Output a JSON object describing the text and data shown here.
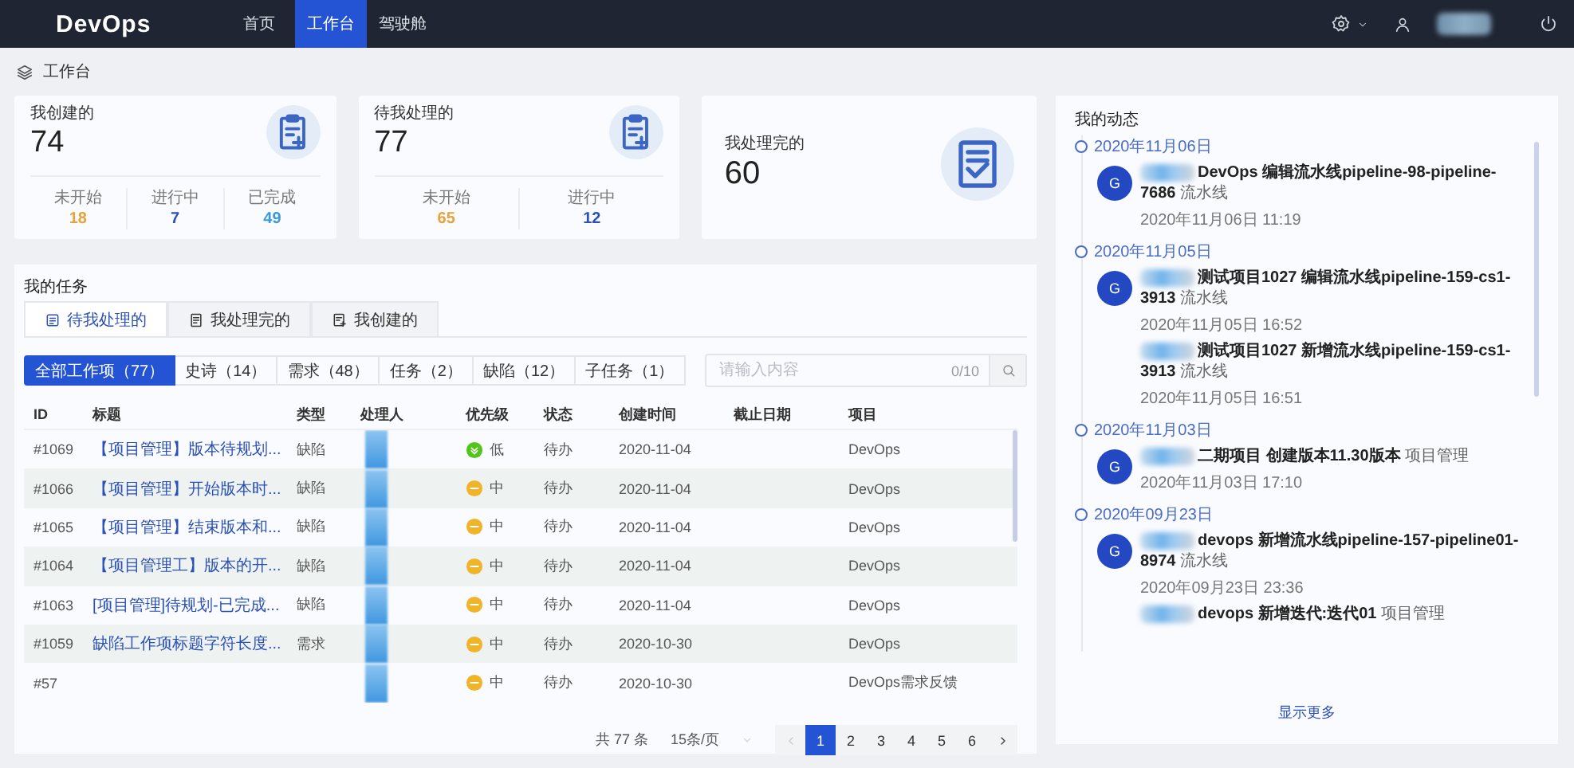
{
  "topbar": {
    "logo": "DevOps",
    "nav": [
      {
        "label": "首页",
        "selected": false
      },
      {
        "label": "工作台",
        "selected": true
      },
      {
        "label": "驾驶舱",
        "selected": false
      }
    ]
  },
  "breadcrumb": "工作台",
  "cards": [
    {
      "title": "我创建的",
      "value": "74",
      "stats": [
        {
          "label": "未开始",
          "value": "18",
          "color": "#e6a23c"
        },
        {
          "label": "进行中",
          "value": "7",
          "color": "#2b50b8"
        },
        {
          "label": "已完成",
          "value": "49",
          "color": "#3a9ad9"
        }
      ]
    },
    {
      "title": "待我处理的",
      "value": "77",
      "stats": [
        {
          "label": "未开始",
          "value": "65",
          "color": "#e6a23c"
        },
        {
          "label": "进行中",
          "value": "12",
          "color": "#2b50b8"
        }
      ]
    },
    {
      "title": "我处理完的",
      "value": "60"
    }
  ],
  "tasks": {
    "title": "我的任务",
    "tabs": [
      {
        "label": "待我处理的",
        "selected": true
      },
      {
        "label": "我处理完的",
        "selected": false
      },
      {
        "label": "我创建的",
        "selected": false
      }
    ],
    "filters": [
      {
        "label": "全部工作项（77）",
        "selected": true
      },
      {
        "label": "史诗（14）",
        "selected": false
      },
      {
        "label": "需求（48）",
        "selected": false
      },
      {
        "label": "任务（2）",
        "selected": false
      },
      {
        "label": "缺陷（12）",
        "selected": false
      },
      {
        "label": "子任务（1）",
        "selected": false
      }
    ],
    "search": {
      "placeholder": "请输入内容",
      "counter": "0/10"
    },
    "columns": [
      "ID",
      "标题",
      "类型",
      "处理人",
      "优先级",
      "状态",
      "创建时间",
      "截止日期",
      "项目"
    ],
    "rows": [
      {
        "id": "#1069",
        "title": "【项目管理】版本待规划...",
        "type": "缺陷",
        "priority": {
          "kind": "low",
          "label": "低"
        },
        "status": "待办",
        "created": "2020-11-04",
        "project": "DevOps"
      },
      {
        "id": "#1066",
        "title": "【项目管理】开始版本时...",
        "type": "缺陷",
        "priority": {
          "kind": "medium",
          "label": "中"
        },
        "status": "待办",
        "created": "2020-11-04",
        "project": "DevOps"
      },
      {
        "id": "#1065",
        "title": "【项目管理】结束版本和...",
        "type": "缺陷",
        "priority": {
          "kind": "medium",
          "label": "中"
        },
        "status": "待办",
        "created": "2020-11-04",
        "project": "DevOps"
      },
      {
        "id": "#1064",
        "title": "【项目管理工】版本的开...",
        "type": "缺陷",
        "priority": {
          "kind": "medium",
          "label": "中"
        },
        "status": "待办",
        "created": "2020-11-04",
        "project": "DevOps"
      },
      {
        "id": "#1063",
        "title": "[项目管理]待规划-已完成...",
        "type": "缺陷",
        "priority": {
          "kind": "medium",
          "label": "中"
        },
        "status": "待办",
        "created": "2020-11-04",
        "project": "DevOps"
      },
      {
        "id": "#1059",
        "title": "缺陷工作项标题字符长度...",
        "type": "需求",
        "priority": {
          "kind": "medium",
          "label": "中"
        },
        "status": "待办",
        "created": "2020-10-30",
        "project": "DevOps"
      },
      {
        "id": "#57",
        "priority": {
          "kind": "medium",
          "label": "中"
        },
        "status": "待办",
        "created": "2020-10-30",
        "project": "DevOps需求反馈"
      }
    ],
    "pagination": {
      "total": "共 77 条",
      "page_size": "15条/页",
      "pages": [
        {
          "label": "1",
          "selected": true
        },
        {
          "label": "2",
          "selected": false
        },
        {
          "label": "3",
          "selected": false
        },
        {
          "label": "4",
          "selected": false
        },
        {
          "label": "5",
          "selected": false
        },
        {
          "label": "6",
          "selected": false
        }
      ]
    }
  },
  "activity": {
    "title": "我的动态",
    "more": "显示更多",
    "groups": [
      {
        "date": "2020年11月06日",
        "items": [
          {
            "avatar": "G",
            "text": "**DevOps 编辑流水线pipeline-98-pipeline-7686** 流水线",
            "time": "2020年11月06日 11:19"
          }
        ]
      },
      {
        "date": "2020年11月05日",
        "items": [
          {
            "avatar": "G",
            "text": "**测试项目1027 编辑流水线pipeline-159-cs1-3913** 流水线",
            "time": "2020年11月05日 16:52"
          },
          {
            "text": "**测试项目1027 新增流水线pipeline-159-cs1-3913** 流水线",
            "time": "2020年11月05日 16:51"
          }
        ]
      },
      {
        "date": "2020年11月03日",
        "items": [
          {
            "avatar": "G",
            "text": "**二期项目 创建版本11.30版本** 项目管理",
            "time": "2020年11月03日 17:10"
          }
        ]
      },
      {
        "date": "2020年09月23日",
        "items": [
          {
            "avatar": "G",
            "text": "**devops 新增流水线pipeline-157-pipeline01-8974** 流水线",
            "time": "2020年09月23日 23:36"
          },
          {
            "text": "**devops 新增迭代:迭代01** 项目管理"
          }
        ]
      }
    ]
  }
}
